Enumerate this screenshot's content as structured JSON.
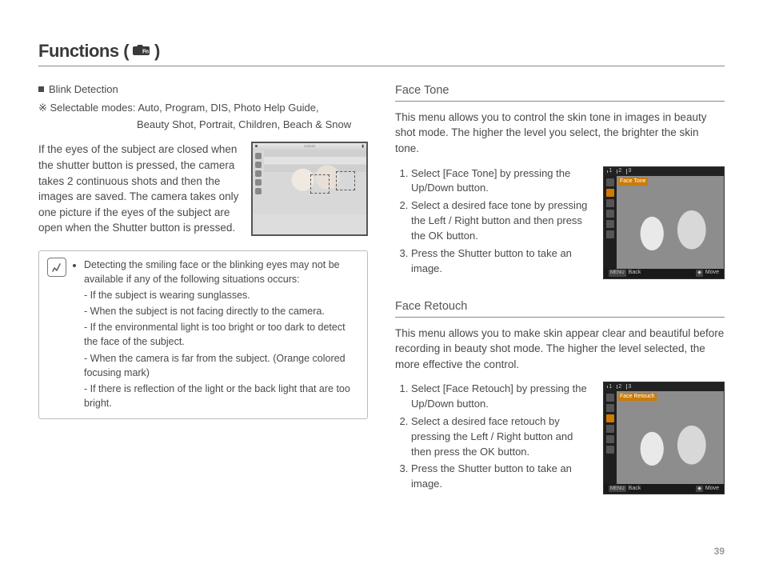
{
  "page_number": "39",
  "title": {
    "prefix": "Functions (",
    "suffix": ")",
    "icon_name": "camera-fn-icon"
  },
  "left": {
    "blink_heading": "Blink Detection",
    "modes_label": "※ Selectable modes:",
    "modes_line1": "Auto, Program, DIS, Photo Help Guide,",
    "modes_line2": "Beauty Shot, Portrait, Children, Beach & Snow",
    "blink_body": "If the eyes of the subject are closed when the shutter button is pressed, the camera takes 2 continuous shots and then the images are saved. The camera takes only one picture if the eyes of the subject are open when the Shutter button is pressed.",
    "note_intro": "Detecting the smiling face or the blinking eyes may not be available if any of the following situations occurs:",
    "note_items": [
      "If the subject is wearing sunglasses.",
      "When the subject is not facing directly to the camera.",
      "If the environmental light is too bright or too dark to detect the face of the subject.",
      "When the camera is far from the subject. (Orange colored focusing mark)",
      "If there is reflection of the light or the back light that are too bright."
    ]
  },
  "right": {
    "face_tone": {
      "heading": "Face Tone",
      "desc": "This menu allows you to control the skin tone in images in beauty shot mode. The higher the level you select, the brighter the skin tone.",
      "steps": [
        "Select [Face Tone] by pressing the Up/Down button.",
        "Select a desired face tone by pressing the Left / Right button and then press the OK button.",
        "Press the Shutter button to take an image."
      ],
      "osd_label": "Face Tone",
      "osd_top_levels": [
        "1",
        "2",
        "3"
      ],
      "osd_back": "Back",
      "osd_back_key": "MENU",
      "osd_move": "Move",
      "osd_move_key": "◆"
    },
    "face_retouch": {
      "heading": "Face Retouch",
      "desc": "This menu allows you to make skin appear clear and beautiful before recording in beauty shot mode. The higher the level selected, the more effective the control.",
      "steps": [
        "Select [Face Retouch] by pressing the Up/Down button.",
        "Select a desired face retouch by pressing the Left / Right button and then press the OK button.",
        "Press the Shutter button to take an image."
      ],
      "osd_label": "Face Retouch",
      "osd_top_levels": [
        "1",
        "2",
        "3"
      ],
      "osd_back": "Back",
      "osd_back_key": "MENU",
      "osd_move": "Move",
      "osd_move_key": "◆"
    }
  }
}
